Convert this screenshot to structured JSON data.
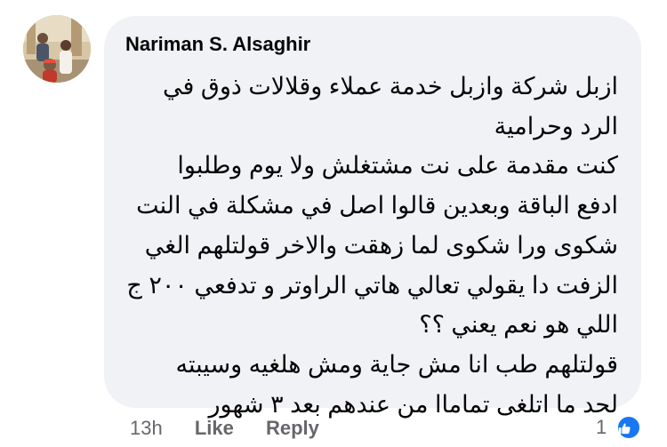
{
  "comment": {
    "author": "Nariman S. Alsaghir",
    "lines": [
      "ازبل شركة وازبل خدمة عملاء وقلالات ذوق في",
      "الرد وحرامية",
      "كنت مقدمة على نت مشتغلش ولا يوم وطلبوا",
      "ادفع الباقة وبعدين قالوا اصل في مشكلة في النت",
      "شكوى ورا شكوى لما زهقت والاخر قولتلهم الغي",
      "الزفت دا يقولي تعالي هاتي الراوتر و تدفعي ٢٠٠ ج",
      "اللي هو نعم يعني ؟؟",
      "قولتلهم طب انا مش جاية ومش هلغيه وسيبته",
      "لحد ما اتلغى تماماا من عندهم بعد ٣ شهور"
    ]
  },
  "actions": {
    "time": "13h",
    "like_label": "Like",
    "reply_label": "Reply"
  },
  "reactions": {
    "count": "1",
    "icon": "thumbs-up-icon",
    "color": "#1877f2"
  },
  "colors": {
    "bubble": "#f0f2f5",
    "text": "#050505",
    "meta": "#65676b"
  }
}
